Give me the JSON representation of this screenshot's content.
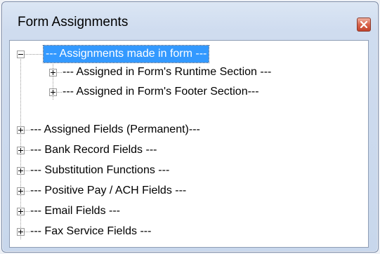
{
  "window": {
    "title": "Form Assignments",
    "close_icon": "close-icon",
    "accent_close": "#c8452e"
  },
  "tree": {
    "root": {
      "label": "--- Assignments made in form ---",
      "expanded": true,
      "selected": true,
      "children": [
        {
          "label": "--- Assigned in Form's Runtime Section  ---"
        },
        {
          "label": "--- Assigned in Form's Footer Section---"
        }
      ]
    },
    "items": [
      {
        "label": "--- Assigned Fields (Permanent)---"
      },
      {
        "label": "--- Bank Record Fields ---"
      },
      {
        "label": "--- Substitution Functions ---"
      },
      {
        "label": "--- Positive Pay / ACH Fields ---"
      },
      {
        "label": "--- Email Fields ---"
      },
      {
        "label": "--- Fax Service Fields ---"
      }
    ],
    "selection_color": "#3399ff"
  }
}
